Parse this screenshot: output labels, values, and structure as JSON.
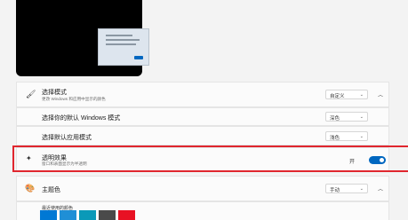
{
  "mode_row": {
    "icon": "brush-icon",
    "title": "选择模式",
    "desc": "更改 Windows 和应用中显示的颜色",
    "value": "自定义",
    "expander": "chevron-up-icon"
  },
  "windows_mode_row": {
    "title": "选择你的默认 Windows 模式",
    "value": "深色"
  },
  "app_mode_row": {
    "title": "选择默认应用模式",
    "value": "浅色"
  },
  "transparency_row": {
    "icon": "sparkle-icon",
    "title": "透明效果",
    "desc": "窗口和表面显示为半透明",
    "toggle_label": "开",
    "toggle_on": true
  },
  "accent_row": {
    "icon": "palette-icon",
    "title": "主题色",
    "value": "手动",
    "expander": "chevron-up-icon"
  },
  "recent_colors": {
    "title": "最近使用的颜色",
    "colors": [
      "#0078d4",
      "#1f8fd6",
      "#0a99b8",
      "#4a4a4a",
      "#e81123"
    ]
  },
  "colors": {
    "accent": "#0067c0",
    "highlight_border": "#e0262e"
  }
}
